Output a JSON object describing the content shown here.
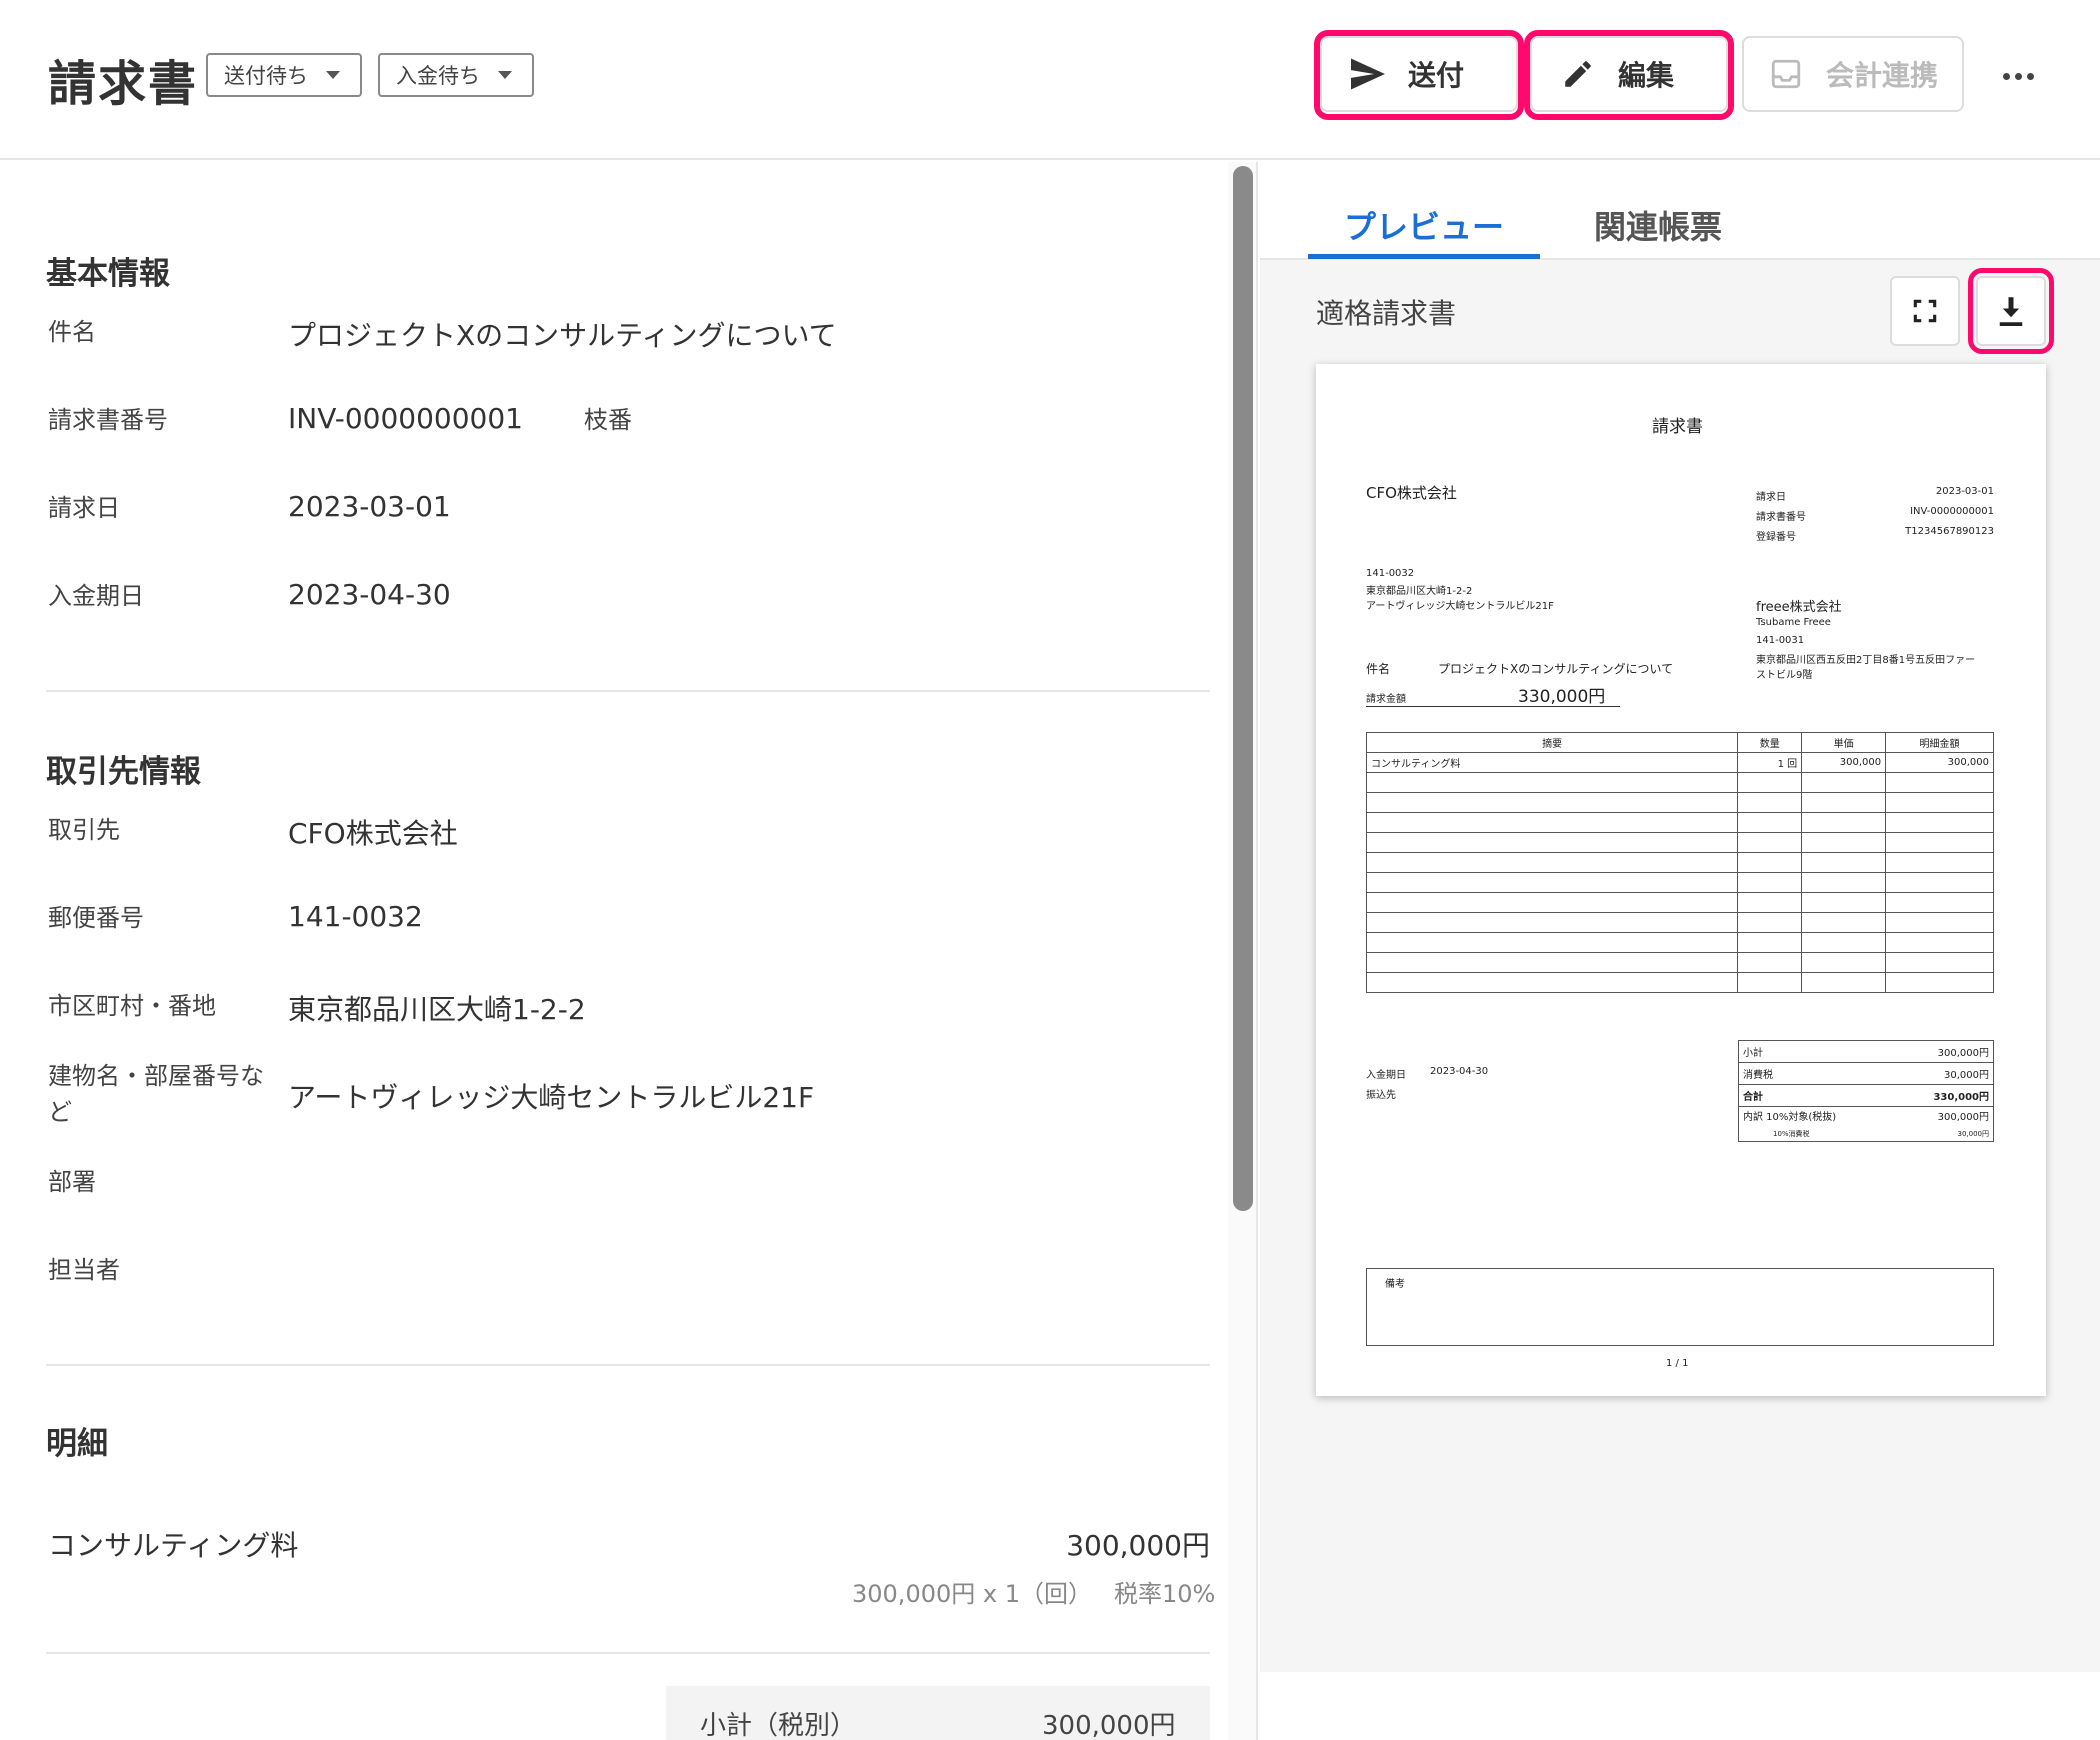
{
  "header": {
    "title": "請求書",
    "send_status": "送付待ち",
    "payment_status": "入金待ち",
    "send_label": "送付",
    "edit_label": "編集",
    "accounting_label": "会計連携"
  },
  "basic": {
    "section_title": "基本情報",
    "subject_label": "件名",
    "subject_value": "プロジェクトXのコンサルティングについて",
    "number_label": "請求書番号",
    "number_value": "INV-0000000001",
    "branch_label": "枝番",
    "date_label": "請求日",
    "date_value": "2023-03-01",
    "due_label": "入金期日",
    "due_value": "2023-04-30"
  },
  "partner": {
    "section_title": "取引先情報",
    "name_label": "取引先",
    "name_value": "CFO株式会社",
    "zip_label": "郵便番号",
    "zip_value": "141-0032",
    "city_label": "市区町村・番地",
    "city_value": "東京都品川区大崎1-2-2",
    "building_label_1": "建物名・部屋番号な",
    "building_label_2": "ど",
    "building_value": "アートヴィレッジ大崎セントラルビル21F",
    "dept_label": "部署",
    "contact_label": "担当者"
  },
  "details": {
    "section_title": "明細",
    "item_name": "コンサルティング料",
    "item_amount": "300,000円",
    "item_breakdown": "300,000円 x 1（回）",
    "item_tax": "税率10%",
    "subtotal_label": "小計（税別）",
    "subtotal_value": "300,000円"
  },
  "tabs": {
    "preview": "プレビュー",
    "related": "関連帳票"
  },
  "preview": {
    "doc_type": "適格請求書",
    "doc_title": "請求書",
    "client_name": "CFO株式会社",
    "client_zip": "141-0032",
    "client_addr1": "東京都品川区大崎1-2-2",
    "client_addr2": "アートヴィレッジ大崎セントラルビル21F",
    "meta_date_label": "請求日",
    "meta_date_value": "2023-03-01",
    "meta_no_label": "請求書番号",
    "meta_no_value": "INV-0000000001",
    "meta_reg_label": "登録番号",
    "meta_reg_value": "T1234567890123",
    "issuer_name": "freee株式会社",
    "issuer_person": "Tsubame Freee",
    "issuer_zip": "141-0031",
    "issuer_addr1": "東京都品川区西五反田2丁目8番1号五反田ファー",
    "issuer_addr2": "ストビル9階",
    "subject_label": "件名",
    "subject_value": "プロジェクトXのコンサルティングについて",
    "amount_label": "請求金額",
    "amount_value": "330,000円",
    "col_desc": "摘要",
    "col_qty": "数量",
    "col_unit": "単価",
    "col_amount": "明細金額",
    "row_desc": "コンサルティング料",
    "row_qty": "1 回",
    "row_unit": "300,000",
    "row_amount": "300,000",
    "due_label": "入金期日",
    "due_value": "2023-04-30",
    "bank_label": "振込先",
    "sub_label": "小計",
    "sub_value": "300,000円",
    "tax_label": "消費税",
    "tax_value": "30,000円",
    "total_label": "合計",
    "total_value": "330,000円",
    "breakdown_label": "内訳  10%対象(税抜)",
    "breakdown_value": "300,000円",
    "breakdown_tax_label": "10%消費税",
    "breakdown_tax_value": "30,000円",
    "remarks_label": "備考",
    "page": "1 / 1"
  },
  "colors": {
    "accent": "#1a6fd6",
    "highlight": "#ff0a6c"
  }
}
